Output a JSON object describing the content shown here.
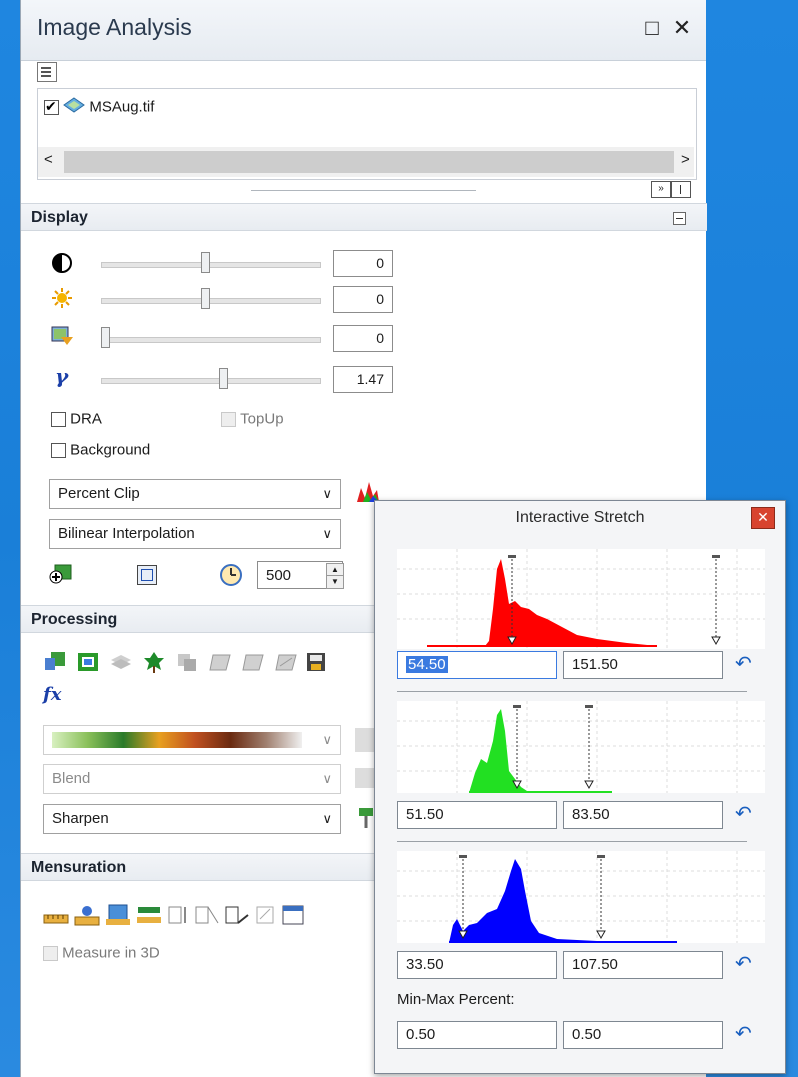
{
  "panel": {
    "title": "Image Analysis",
    "layer_name": "MSAug.tif",
    "layer_checked": true,
    "scroll_left": "<",
    "scroll_right": ">"
  },
  "display": {
    "header": "Display",
    "contrast_value": "0",
    "brightness_value": "0",
    "transparency_value": "0",
    "gamma_value": "1.47",
    "dra_label": "DRA",
    "topup_label": "TopUp",
    "background_label": "Background",
    "stretch_select": "Percent Clip",
    "resample_select": "Bilinear Interpolation",
    "refresh_value": "500"
  },
  "processing": {
    "header": "Processing",
    "blend_select": "Blend",
    "sharpen_select": "Sharpen"
  },
  "mensuration": {
    "header": "Mensuration",
    "measure3d_label": "Measure in 3D"
  },
  "dialog": {
    "title": "Interactive Stretch",
    "red_min": "54.50",
    "red_max": "151.50",
    "green_min": "51.50",
    "green_max": "83.50",
    "blue_min": "33.50",
    "blue_max": "107.50",
    "minmax_label": "Min-Max Percent:",
    "minmax_low": "0.50",
    "minmax_high": "0.50"
  },
  "colors": {
    "red": "#ff0000",
    "green": "#22e022",
    "blue": "#0000ff"
  }
}
